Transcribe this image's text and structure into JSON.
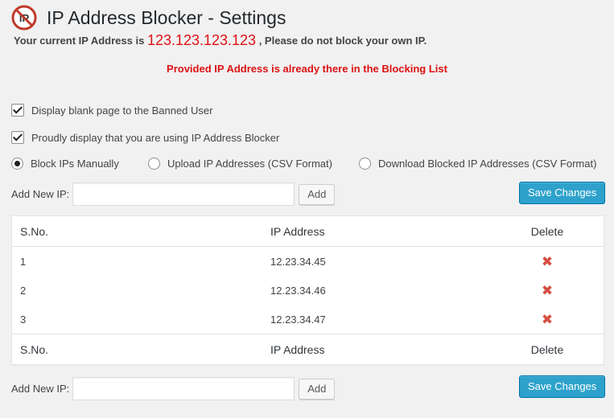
{
  "header": {
    "title": "IP Address Blocker - Settings",
    "ip_prefix": "Your current IP Address is",
    "current_ip": "123.123.123.123",
    "ip_suffix": ", Please do not block your own IP."
  },
  "error_message": "Provided IP Address is already there in the Blocking List",
  "options": {
    "blank_page": {
      "label": "Display blank page to the Banned User",
      "checked": true
    },
    "proudly": {
      "label": "Proudly display that you are using IP Address Blocker",
      "checked": true
    }
  },
  "modes": [
    {
      "label": "Block IPs Manually",
      "selected": true
    },
    {
      "label": "Upload IP Addresses (CSV Format)",
      "selected": false
    },
    {
      "label": "Download Blocked IP Addresses (CSV Format)",
      "selected": false
    }
  ],
  "add_form": {
    "label": "Add New IP:",
    "value": "",
    "add_button": "Add",
    "save_button": "Save Changes"
  },
  "table": {
    "columns": [
      "S.No.",
      "IP Address",
      "Delete"
    ],
    "rows": [
      {
        "sno": "1",
        "ip": "12.23.34.45"
      },
      {
        "sno": "2",
        "ip": "12.23.34.46"
      },
      {
        "sno": "3",
        "ip": "12.23.34.47"
      }
    ]
  },
  "icons": {
    "logo": "no-ip-logo-icon",
    "delete": "delete-x-icon"
  },
  "colors": {
    "error": "#dd1111",
    "primary": "#2ea2cc",
    "delete": "#d54e41"
  }
}
